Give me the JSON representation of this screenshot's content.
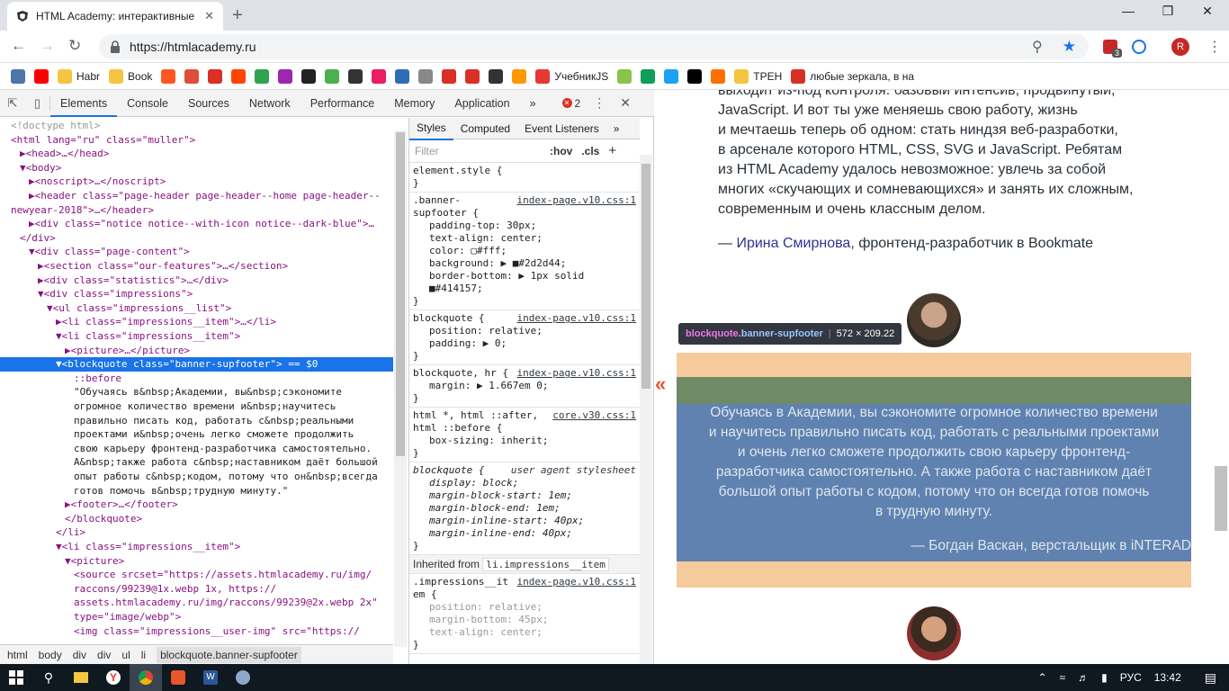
{
  "browser": {
    "tab_title": "HTML Academy: интерактивные",
    "tab_close": "✕",
    "new_tab": "+",
    "url": "https://htmlacademy.ru",
    "profile_initial": "R",
    "ext_badge": "3"
  },
  "bookmarks": [
    {
      "label": "",
      "color": "#4a76a8",
      "icon": "vk-icon"
    },
    {
      "label": "",
      "color": "#ff0000",
      "icon": "youtube-icon"
    },
    {
      "label": "Habr",
      "color": "#f5c542",
      "icon": "folder-icon"
    },
    {
      "label": "Book",
      "color": "#f5c542",
      "icon": "folder-icon"
    },
    {
      "label": "",
      "color": "#ff5722",
      "icon": "pocket-icon"
    },
    {
      "label": "",
      "color": "#e04e39",
      "icon": "bookmark-icon"
    },
    {
      "label": "",
      "color": "#d93025",
      "icon": "bookmark-icon"
    },
    {
      "label": "",
      "color": "#ff4500",
      "icon": "lf-icon"
    },
    {
      "label": "",
      "color": "#2ea44f",
      "icon": "bookmark-icon"
    },
    {
      "label": "",
      "color": "#9c27b0",
      "icon": "bookmark-icon"
    },
    {
      "label": "",
      "color": "#222222",
      "icon": "bs-icon"
    },
    {
      "label": "",
      "color": "#4caf50",
      "icon": "bookmark-icon"
    },
    {
      "label": "",
      "color": "#333333",
      "icon": "bookmark-icon"
    },
    {
      "label": "",
      "color": "#e91e63",
      "icon": "bookmark-icon"
    },
    {
      "label": "",
      "color": "#2d6db5",
      "icon": "bookmark-icon"
    },
    {
      "label": "",
      "color": "#888888",
      "icon": "page-icon"
    },
    {
      "label": "",
      "color": "#d93025",
      "icon": "bookmark-icon"
    },
    {
      "label": "",
      "color": "#d93025",
      "icon": "bookmark-icon"
    },
    {
      "label": "",
      "color": "#333333",
      "icon": "shield-icon"
    },
    {
      "label": "",
      "color": "#ff9800",
      "icon": "bookmark-icon"
    },
    {
      "label": "УчебникJS",
      "color": "#e53935",
      "icon": "bookmark-icon"
    },
    {
      "label": "",
      "color": "#8bc34a",
      "icon": "bookmark-icon"
    },
    {
      "label": "",
      "color": "#0f9d58",
      "icon": "sheets-icon"
    },
    {
      "label": "",
      "color": "#1da1f2",
      "icon": "bookmark-icon"
    },
    {
      "label": "",
      "color": "#000000",
      "icon": "home-icon"
    },
    {
      "label": "",
      "color": "#ff6f00",
      "icon": "ru-icon"
    },
    {
      "label": "ТРЕН",
      "color": "#f5c542",
      "icon": "folder-icon"
    },
    {
      "label": "любые зеркала, в на",
      "color": "#d93025",
      "icon": "bookmark-icon"
    }
  ],
  "devtools": {
    "tabs": [
      "Elements",
      "Console",
      "Sources",
      "Network",
      "Performance",
      "Memory",
      "Application"
    ],
    "more": "»",
    "errors": "2",
    "styles_tabs": [
      "Styles",
      "Computed",
      "Event Listeners"
    ],
    "filter_placeholder": "Filter",
    "hov": ":hov",
    "cls": ".cls",
    "plus": "+",
    "breadcrumbs": [
      "html",
      "body",
      "div",
      "div",
      "ul",
      "li",
      "blockquote.banner-supfooter"
    ],
    "inherited_from_label": "Inherited from",
    "inherited_from_value": "li.impressions__item",
    "dom_lines": [
      "<!doctype html>",
      "<html lang=\"ru\" class=\"muller\">",
      "▶<head>…</head>",
      "▼<body>",
      "▶<noscript>…</noscript>",
      "▶<header class=\"page-header page-header--home page-header--",
      "newyear-2018\">…</header>",
      "▶<div class=\"notice notice--with-icon notice--dark-blue\">…",
      "</div>",
      "▼<div class=\"page-content\">",
      "▶<section class=\"our-features\">…</section>",
      "▶<div class=\"statistics\">…</div>",
      "▼<div class=\"impressions\">",
      "▼<ul class=\"impressions__list\">",
      "▶<li class=\"impressions__item\">…</li>",
      "▼<li class=\"impressions__item\">",
      "▶<picture>…</picture>",
      "▼<blockquote class=\"banner-supfooter\"> == $0",
      "::before",
      "\"Обучаясь в&nbsp;Академии, вы&nbsp;сэкономите",
      "огромное количество времени и&nbsp;научитесь",
      "правильно писать код, работать с&nbsp;реальными",
      "проектами и&nbsp;очень легко сможете продолжить",
      "свою карьеру фронтенд-разработчика самостоятельно.",
      "А&nbsp;также работа с&nbsp;наставником даёт большой",
      "опыт работы с&nbsp;кодом, потому что он&nbsp;всегда",
      "готов помочь в&nbsp;трудную минуту.\"",
      "▶<footer>…</footer>",
      "</blockquote>",
      "</li>",
      "▼<li class=\"impressions__item\">",
      "▼<picture>",
      "<source srcset=\"https://assets.htmlacademy.ru/img/",
      "raccons/99239@1x.webp 1x, https://",
      "assets.htmlacademy.ru/img/raccons/99239@2x.webp 2x\"",
      "type=\"image/webp\">",
      "<img class=\"impressions__user-img\" src=\"https://"
    ],
    "styles": {
      "element_style": "element.style {",
      "rule1_selector": ".banner-",
      "rule1_selector2": "supfooter {",
      "rule1_src": "index-page.v10.css:1",
      "rule1_props": [
        "padding-top: 30px;",
        "text-align: center;",
        "color: ▢#fff;",
        "background: ▶ ■#2d2d44;",
        "border-bottom: ▶ 1px solid",
        "■#414157;"
      ],
      "rule2_selector": "blockquote {",
      "rule2_src": "index-page.v10.css:1",
      "rule2_props": [
        "position: relative;",
        "padding: ▶ 0;"
      ],
      "rule3_selector": "blockquote, hr {",
      "rule3_src": "index-page.v10.css:1",
      "rule3_props": [
        "margin: ▶ 1.667em 0;"
      ],
      "rule4_selector": "html *, html ::after,",
      "rule4_selector2": "html ::before {",
      "rule4_src": "core.v30.css:1",
      "rule4_props": [
        "box-sizing: inherit;"
      ],
      "rule5_selector": "blockquote {",
      "rule5_src": "user agent stylesheet",
      "rule5_props": [
        "display: block;",
        "margin-block-start: 1em;",
        "margin-block-end: 1em;",
        "margin-inline-start: 40px;",
        "margin-inline-end: 40px;"
      ],
      "rule6_selector": ".impressions__it",
      "rule6_selector2": "em {",
      "rule6_src": "index-page.v10.css:1",
      "rule6_props": [
        "position: relative;",
        "margin-bottom: 45px;",
        "text-align: center;"
      ],
      "close_brace": "}"
    }
  },
  "page": {
    "quote_lines": [
      "выходит из-под контроля: базовый интенсив, продвинутый,",
      "JavaScript. И вот ты уже меняешь свою работу, жизнь",
      "и мечтаешь теперь об одном: стать ниндзя веб-разработки,",
      "в арсенале которого HTML, CSS, SVG и JavaScript. Ребятам",
      "из HTML Academy удалось невозможное: увлечь за собой",
      "многих «скучающих и сомневающихся» и занять их сложным,",
      "современным и очень классным делом."
    ],
    "author_prefix": "— ",
    "author_name": "Ирина Смирнова",
    "author_suffix": ", фронтенд-разработчик в Bookmate",
    "tooltip_tag": "blockquote",
    "tooltip_class": ".banner-supfooter",
    "tooltip_size": "572 × 209.22",
    "chevron": "«",
    "banner_lines": [
      "Обучаясь в Академии, вы сэкономите огромное количество времени",
      "и научитесь правильно писать код, работать с реальными проектами",
      "и очень легко сможете продолжить свою карьеру фронтенд-",
      "разработчика самостоятельно. А также работа с наставником даёт",
      "большой опыт работы с кодом, потому что он всегда готов помочь",
      "в трудную минуту."
    ],
    "banner_author": "— Богдан Васкан, верстальщик в iNTERAD",
    "colors": {
      "margin_overlay": "#f6cb9c",
      "padding_overlay": "#6e8a66",
      "content_overlay": "#5f82b0",
      "link": "#2f3590"
    }
  },
  "taskbar": {
    "lang": "РУС",
    "time": "13:42"
  }
}
